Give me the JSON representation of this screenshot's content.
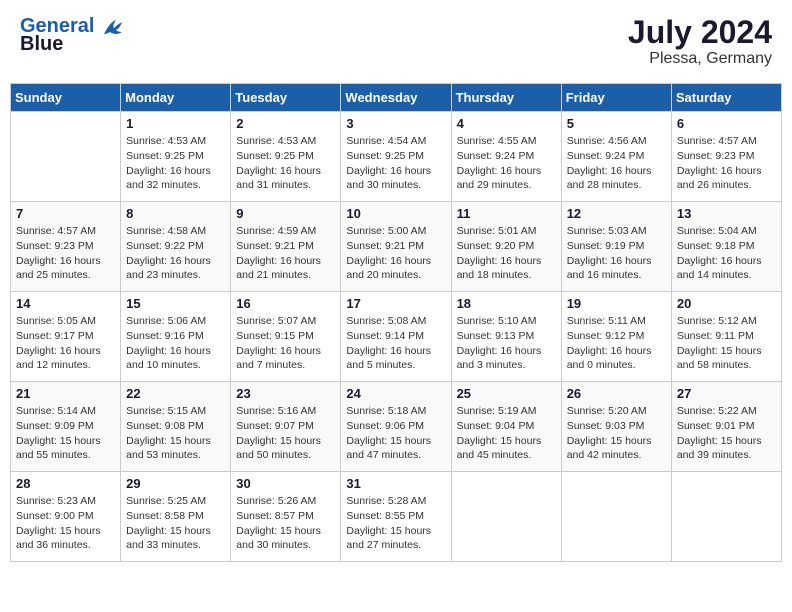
{
  "header": {
    "logo_line1": "General",
    "logo_line2": "Blue",
    "month_year": "July 2024",
    "location": "Plessa, Germany"
  },
  "columns": [
    "Sunday",
    "Monday",
    "Tuesday",
    "Wednesday",
    "Thursday",
    "Friday",
    "Saturday"
  ],
  "weeks": [
    [
      {
        "day": "",
        "info": ""
      },
      {
        "day": "1",
        "info": "Sunrise: 4:53 AM\nSunset: 9:25 PM\nDaylight: 16 hours\nand 32 minutes."
      },
      {
        "day": "2",
        "info": "Sunrise: 4:53 AM\nSunset: 9:25 PM\nDaylight: 16 hours\nand 31 minutes."
      },
      {
        "day": "3",
        "info": "Sunrise: 4:54 AM\nSunset: 9:25 PM\nDaylight: 16 hours\nand 30 minutes."
      },
      {
        "day": "4",
        "info": "Sunrise: 4:55 AM\nSunset: 9:24 PM\nDaylight: 16 hours\nand 29 minutes."
      },
      {
        "day": "5",
        "info": "Sunrise: 4:56 AM\nSunset: 9:24 PM\nDaylight: 16 hours\nand 28 minutes."
      },
      {
        "day": "6",
        "info": "Sunrise: 4:57 AM\nSunset: 9:23 PM\nDaylight: 16 hours\nand 26 minutes."
      }
    ],
    [
      {
        "day": "7",
        "info": "Sunrise: 4:57 AM\nSunset: 9:23 PM\nDaylight: 16 hours\nand 25 minutes."
      },
      {
        "day": "8",
        "info": "Sunrise: 4:58 AM\nSunset: 9:22 PM\nDaylight: 16 hours\nand 23 minutes."
      },
      {
        "day": "9",
        "info": "Sunrise: 4:59 AM\nSunset: 9:21 PM\nDaylight: 16 hours\nand 21 minutes."
      },
      {
        "day": "10",
        "info": "Sunrise: 5:00 AM\nSunset: 9:21 PM\nDaylight: 16 hours\nand 20 minutes."
      },
      {
        "day": "11",
        "info": "Sunrise: 5:01 AM\nSunset: 9:20 PM\nDaylight: 16 hours\nand 18 minutes."
      },
      {
        "day": "12",
        "info": "Sunrise: 5:03 AM\nSunset: 9:19 PM\nDaylight: 16 hours\nand 16 minutes."
      },
      {
        "day": "13",
        "info": "Sunrise: 5:04 AM\nSunset: 9:18 PM\nDaylight: 16 hours\nand 14 minutes."
      }
    ],
    [
      {
        "day": "14",
        "info": "Sunrise: 5:05 AM\nSunset: 9:17 PM\nDaylight: 16 hours\nand 12 minutes."
      },
      {
        "day": "15",
        "info": "Sunrise: 5:06 AM\nSunset: 9:16 PM\nDaylight: 16 hours\nand 10 minutes."
      },
      {
        "day": "16",
        "info": "Sunrise: 5:07 AM\nSunset: 9:15 PM\nDaylight: 16 hours\nand 7 minutes."
      },
      {
        "day": "17",
        "info": "Sunrise: 5:08 AM\nSunset: 9:14 PM\nDaylight: 16 hours\nand 5 minutes."
      },
      {
        "day": "18",
        "info": "Sunrise: 5:10 AM\nSunset: 9:13 PM\nDaylight: 16 hours\nand 3 minutes."
      },
      {
        "day": "19",
        "info": "Sunrise: 5:11 AM\nSunset: 9:12 PM\nDaylight: 16 hours\nand 0 minutes."
      },
      {
        "day": "20",
        "info": "Sunrise: 5:12 AM\nSunset: 9:11 PM\nDaylight: 15 hours\nand 58 minutes."
      }
    ],
    [
      {
        "day": "21",
        "info": "Sunrise: 5:14 AM\nSunset: 9:09 PM\nDaylight: 15 hours\nand 55 minutes."
      },
      {
        "day": "22",
        "info": "Sunrise: 5:15 AM\nSunset: 9:08 PM\nDaylight: 15 hours\nand 53 minutes."
      },
      {
        "day": "23",
        "info": "Sunrise: 5:16 AM\nSunset: 9:07 PM\nDaylight: 15 hours\nand 50 minutes."
      },
      {
        "day": "24",
        "info": "Sunrise: 5:18 AM\nSunset: 9:06 PM\nDaylight: 15 hours\nand 47 minutes."
      },
      {
        "day": "25",
        "info": "Sunrise: 5:19 AM\nSunset: 9:04 PM\nDaylight: 15 hours\nand 45 minutes."
      },
      {
        "day": "26",
        "info": "Sunrise: 5:20 AM\nSunset: 9:03 PM\nDaylight: 15 hours\nand 42 minutes."
      },
      {
        "day": "27",
        "info": "Sunrise: 5:22 AM\nSunset: 9:01 PM\nDaylight: 15 hours\nand 39 minutes."
      }
    ],
    [
      {
        "day": "28",
        "info": "Sunrise: 5:23 AM\nSunset: 9:00 PM\nDaylight: 15 hours\nand 36 minutes."
      },
      {
        "day": "29",
        "info": "Sunrise: 5:25 AM\nSunset: 8:58 PM\nDaylight: 15 hours\nand 33 minutes."
      },
      {
        "day": "30",
        "info": "Sunrise: 5:26 AM\nSunset: 8:57 PM\nDaylight: 15 hours\nand 30 minutes."
      },
      {
        "day": "31",
        "info": "Sunrise: 5:28 AM\nSunset: 8:55 PM\nDaylight: 15 hours\nand 27 minutes."
      },
      {
        "day": "",
        "info": ""
      },
      {
        "day": "",
        "info": ""
      },
      {
        "day": "",
        "info": ""
      }
    ]
  ]
}
